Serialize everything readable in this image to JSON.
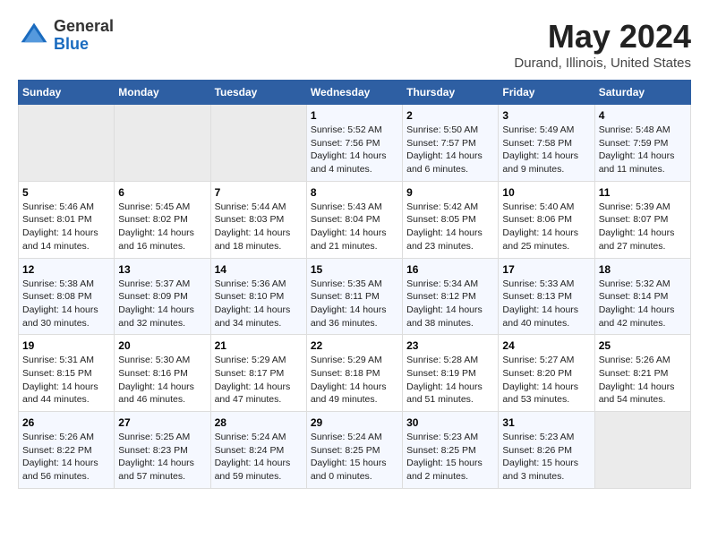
{
  "header": {
    "logo_general": "General",
    "logo_blue": "Blue",
    "main_title": "May 2024",
    "subtitle": "Durand, Illinois, United States"
  },
  "weekdays": [
    "Sunday",
    "Monday",
    "Tuesday",
    "Wednesday",
    "Thursday",
    "Friday",
    "Saturday"
  ],
  "weeks": [
    [
      {
        "day": "",
        "info": ""
      },
      {
        "day": "",
        "info": ""
      },
      {
        "day": "",
        "info": ""
      },
      {
        "day": "1",
        "info": "Sunrise: 5:52 AM\nSunset: 7:56 PM\nDaylight: 14 hours\nand 4 minutes."
      },
      {
        "day": "2",
        "info": "Sunrise: 5:50 AM\nSunset: 7:57 PM\nDaylight: 14 hours\nand 6 minutes."
      },
      {
        "day": "3",
        "info": "Sunrise: 5:49 AM\nSunset: 7:58 PM\nDaylight: 14 hours\nand 9 minutes."
      },
      {
        "day": "4",
        "info": "Sunrise: 5:48 AM\nSunset: 7:59 PM\nDaylight: 14 hours\nand 11 minutes."
      }
    ],
    [
      {
        "day": "5",
        "info": "Sunrise: 5:46 AM\nSunset: 8:01 PM\nDaylight: 14 hours\nand 14 minutes."
      },
      {
        "day": "6",
        "info": "Sunrise: 5:45 AM\nSunset: 8:02 PM\nDaylight: 14 hours\nand 16 minutes."
      },
      {
        "day": "7",
        "info": "Sunrise: 5:44 AM\nSunset: 8:03 PM\nDaylight: 14 hours\nand 18 minutes."
      },
      {
        "day": "8",
        "info": "Sunrise: 5:43 AM\nSunset: 8:04 PM\nDaylight: 14 hours\nand 21 minutes."
      },
      {
        "day": "9",
        "info": "Sunrise: 5:42 AM\nSunset: 8:05 PM\nDaylight: 14 hours\nand 23 minutes."
      },
      {
        "day": "10",
        "info": "Sunrise: 5:40 AM\nSunset: 8:06 PM\nDaylight: 14 hours\nand 25 minutes."
      },
      {
        "day": "11",
        "info": "Sunrise: 5:39 AM\nSunset: 8:07 PM\nDaylight: 14 hours\nand 27 minutes."
      }
    ],
    [
      {
        "day": "12",
        "info": "Sunrise: 5:38 AM\nSunset: 8:08 PM\nDaylight: 14 hours\nand 30 minutes."
      },
      {
        "day": "13",
        "info": "Sunrise: 5:37 AM\nSunset: 8:09 PM\nDaylight: 14 hours\nand 32 minutes."
      },
      {
        "day": "14",
        "info": "Sunrise: 5:36 AM\nSunset: 8:10 PM\nDaylight: 14 hours\nand 34 minutes."
      },
      {
        "day": "15",
        "info": "Sunrise: 5:35 AM\nSunset: 8:11 PM\nDaylight: 14 hours\nand 36 minutes."
      },
      {
        "day": "16",
        "info": "Sunrise: 5:34 AM\nSunset: 8:12 PM\nDaylight: 14 hours\nand 38 minutes."
      },
      {
        "day": "17",
        "info": "Sunrise: 5:33 AM\nSunset: 8:13 PM\nDaylight: 14 hours\nand 40 minutes."
      },
      {
        "day": "18",
        "info": "Sunrise: 5:32 AM\nSunset: 8:14 PM\nDaylight: 14 hours\nand 42 minutes."
      }
    ],
    [
      {
        "day": "19",
        "info": "Sunrise: 5:31 AM\nSunset: 8:15 PM\nDaylight: 14 hours\nand 44 minutes."
      },
      {
        "day": "20",
        "info": "Sunrise: 5:30 AM\nSunset: 8:16 PM\nDaylight: 14 hours\nand 46 minutes."
      },
      {
        "day": "21",
        "info": "Sunrise: 5:29 AM\nSunset: 8:17 PM\nDaylight: 14 hours\nand 47 minutes."
      },
      {
        "day": "22",
        "info": "Sunrise: 5:29 AM\nSunset: 8:18 PM\nDaylight: 14 hours\nand 49 minutes."
      },
      {
        "day": "23",
        "info": "Sunrise: 5:28 AM\nSunset: 8:19 PM\nDaylight: 14 hours\nand 51 minutes."
      },
      {
        "day": "24",
        "info": "Sunrise: 5:27 AM\nSunset: 8:20 PM\nDaylight: 14 hours\nand 53 minutes."
      },
      {
        "day": "25",
        "info": "Sunrise: 5:26 AM\nSunset: 8:21 PM\nDaylight: 14 hours\nand 54 minutes."
      }
    ],
    [
      {
        "day": "26",
        "info": "Sunrise: 5:26 AM\nSunset: 8:22 PM\nDaylight: 14 hours\nand 56 minutes."
      },
      {
        "day": "27",
        "info": "Sunrise: 5:25 AM\nSunset: 8:23 PM\nDaylight: 14 hours\nand 57 minutes."
      },
      {
        "day": "28",
        "info": "Sunrise: 5:24 AM\nSunset: 8:24 PM\nDaylight: 14 hours\nand 59 minutes."
      },
      {
        "day": "29",
        "info": "Sunrise: 5:24 AM\nSunset: 8:25 PM\nDaylight: 15 hours\nand 0 minutes."
      },
      {
        "day": "30",
        "info": "Sunrise: 5:23 AM\nSunset: 8:25 PM\nDaylight: 15 hours\nand 2 minutes."
      },
      {
        "day": "31",
        "info": "Sunrise: 5:23 AM\nSunset: 8:26 PM\nDaylight: 15 hours\nand 3 minutes."
      },
      {
        "day": "",
        "info": ""
      }
    ]
  ]
}
